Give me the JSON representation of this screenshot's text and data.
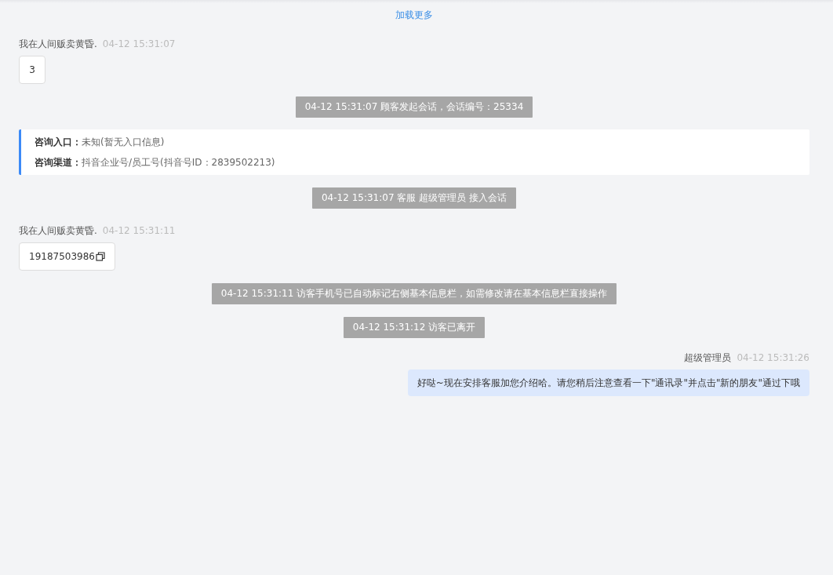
{
  "load_more": "加载更多",
  "messages": [
    {
      "kind": "visitor",
      "sender": "我在人间贩卖黄昏.",
      "time": "04-12 15:31:07",
      "text": "3",
      "copyable": false
    },
    {
      "kind": "system",
      "text": "04-12 15:31:07 顾客发起会话，会话编号：25334"
    },
    {
      "kind": "info",
      "rows": [
        {
          "label": "咨询入口：",
          "value": "未知(暂无入口信息)"
        },
        {
          "label": "咨询渠道：",
          "value": "抖音企业号/员工号(抖音号ID：2839502213)"
        }
      ]
    },
    {
      "kind": "system",
      "text": "04-12 15:31:07 客服 超级管理员 接入会话"
    },
    {
      "kind": "visitor",
      "sender": "我在人间贩卖黄昏.",
      "time": "04-12 15:31:11",
      "text": "19187503986",
      "copyable": true
    },
    {
      "kind": "system",
      "text": "04-12 15:31:11 访客手机号已自动标记右侧基本信息栏，如需修改请在基本信息栏直接操作"
    },
    {
      "kind": "system",
      "text": "04-12 15:31:12 访客已离开"
    },
    {
      "kind": "agent",
      "sender": "超级管理员",
      "time": "04-12 15:31:26",
      "text": "好哒~现在安排客服加您介绍哈。请您稍后注意查看一下\"通讯录\"并点击\"新的朋友\"通过下哦"
    }
  ]
}
